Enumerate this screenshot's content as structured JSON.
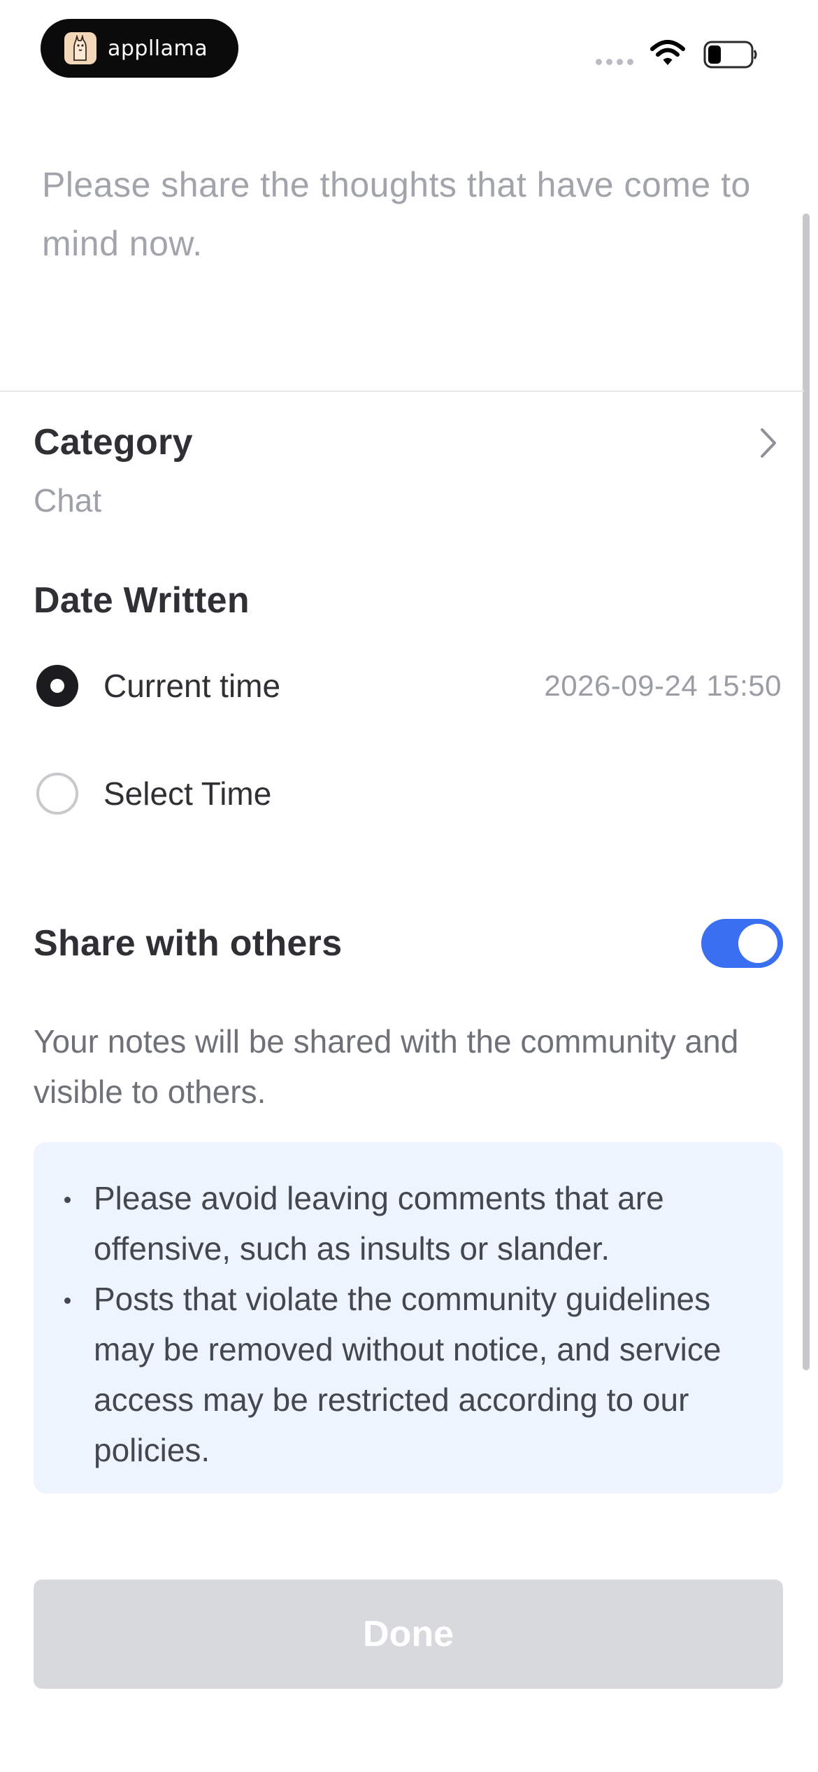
{
  "status_bar": {
    "brand_name": "appllama",
    "icons": [
      "brand-logo-icon",
      "signal-icon",
      "wifi-icon",
      "battery-icon"
    ]
  },
  "note": {
    "placeholder": "Please share the thoughts that have come to mind now."
  },
  "category": {
    "title": "Category",
    "value": "Chat"
  },
  "date_written": {
    "title": "Date Written",
    "options": [
      {
        "label": "Current time",
        "value": "2026-09-24 15:50",
        "selected": true
      },
      {
        "label": "Select Time",
        "value": "",
        "selected": false
      }
    ]
  },
  "share": {
    "title": "Share with others",
    "enabled": true,
    "description": "Your notes will be shared with the community and visible to others.",
    "guidelines": [
      "Please avoid leaving comments that are offensive, such as insults or slander.",
      "Posts that violate the community guidelines may be removed without notice, and service access may be restricted according to our policies."
    ]
  },
  "done_label": "Done",
  "colors": {
    "accent": "#3a6ff2",
    "guideline_bg": "#eef4fe",
    "disabled_button": "#d8d9dc"
  }
}
